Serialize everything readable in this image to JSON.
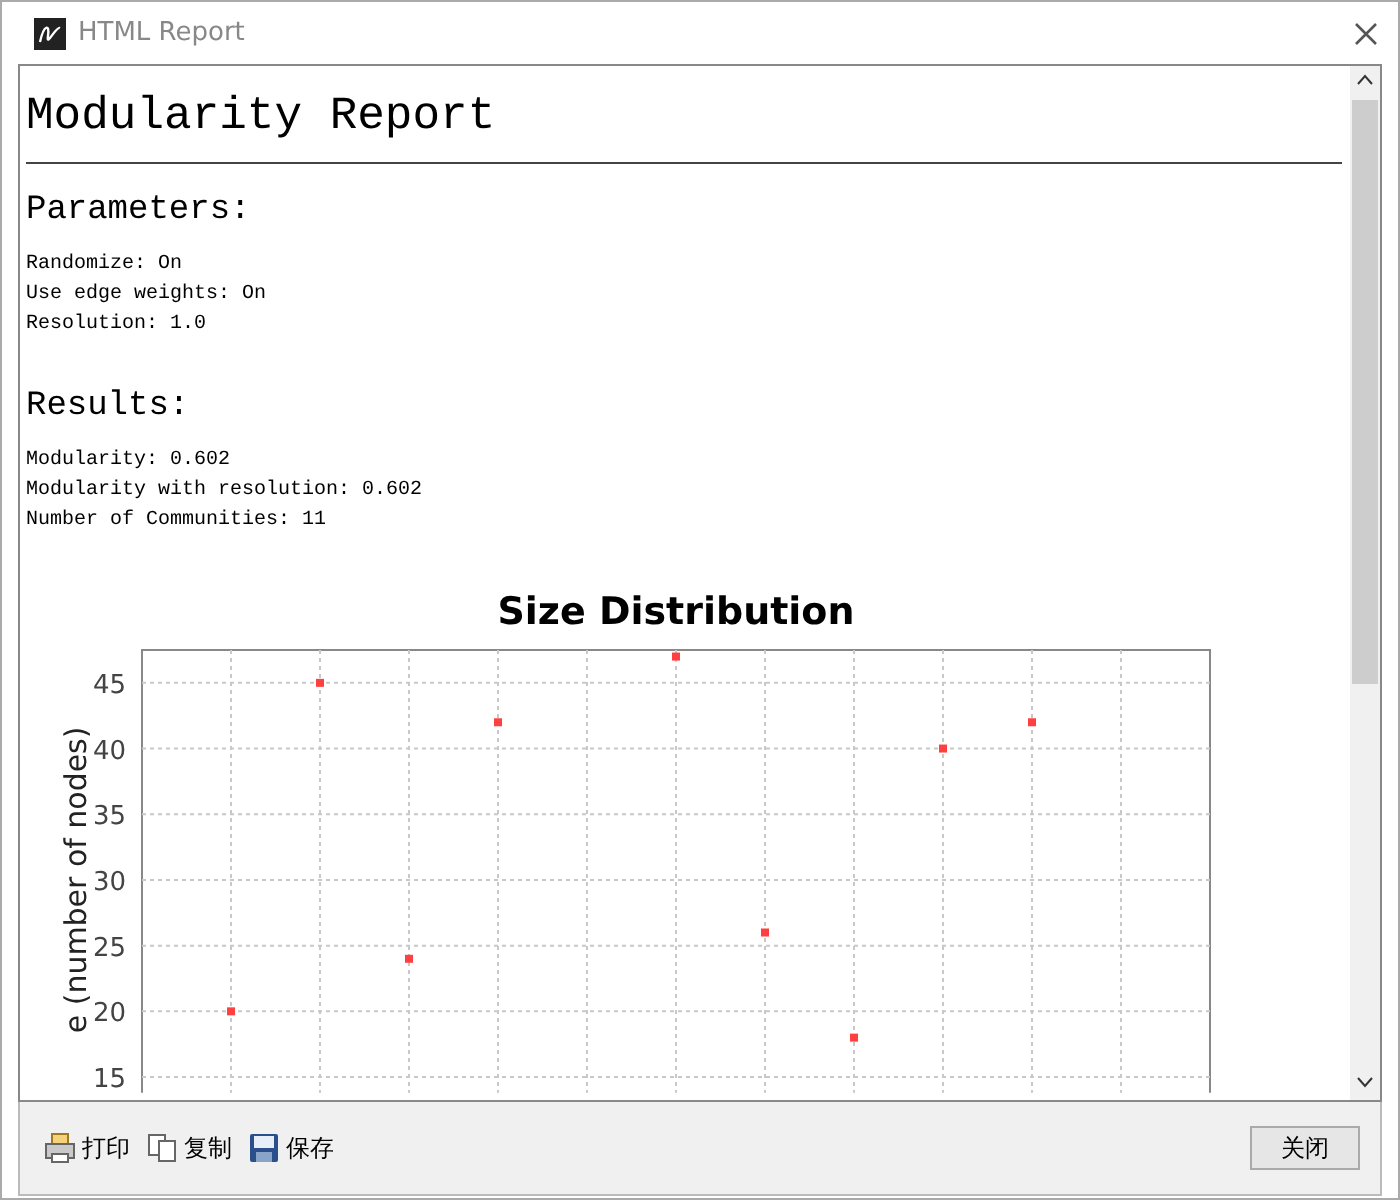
{
  "window": {
    "title": "HTML Report"
  },
  "report": {
    "title": "Modularity Report",
    "sections": [
      {
        "heading": "Parameters:",
        "lines": [
          "Randomize: On",
          "Use edge weights: On",
          "Resolution: 1.0"
        ]
      },
      {
        "heading": "Results:",
        "lines": [
          "Modularity: 0.602",
          "Modularity with resolution: 0.602",
          "Number of Communities: 11"
        ]
      }
    ],
    "chart_data": {
      "type": "scatter",
      "title": "Size Distribution",
      "ylabel": "e (number of nodes)",
      "categories": [
        null,
        null,
        null,
        null,
        null,
        null,
        null,
        null,
        null,
        null,
        null
      ],
      "ylim": [
        13.8,
        47.5
      ],
      "grid": true,
      "yticks": [
        15,
        20,
        25,
        30,
        35,
        40,
        45
      ],
      "series": [
        {
          "color": "#ff4040",
          "values": [
            20,
            45,
            24,
            42,
            null,
            47,
            26,
            18,
            40,
            42,
            null
          ]
        }
      ]
    }
  },
  "toolbar": [
    {
      "kind": "print",
      "label": "打印"
    },
    {
      "kind": "copy",
      "label": "复制"
    },
    {
      "kind": "save",
      "label": "保存"
    }
  ],
  "close_button": "关闭"
}
